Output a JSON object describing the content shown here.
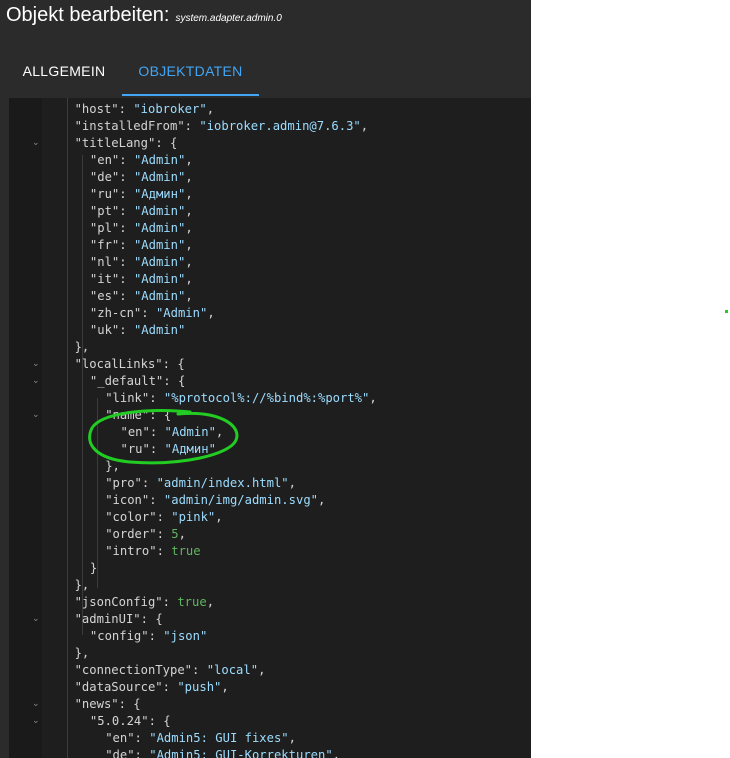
{
  "dialog": {
    "title": "Objekt bearbeiten:",
    "object_id": "system.adapter.admin.0"
  },
  "tabs": [
    {
      "label": "ALLGEMEIN",
      "active": false
    },
    {
      "label": "OBJEKTDATEN",
      "active": true
    }
  ],
  "colors": {
    "background": "#2b2b2b",
    "editor_background": "#1e1e1e",
    "accent": "#42a5f5",
    "string": "#9cdcfe",
    "literal": "#5fb65f",
    "annotation": "#22cc22"
  },
  "code_lines": [
    {
      "indent": 2,
      "tokens": [
        [
          "k",
          "\"host\""
        ],
        [
          "p",
          ": "
        ],
        [
          "s",
          "\"iobroker\""
        ],
        [
          "p",
          ","
        ]
      ]
    },
    {
      "indent": 2,
      "tokens": [
        [
          "k",
          "\"installedFrom\""
        ],
        [
          "p",
          ": "
        ],
        [
          "s",
          "\"iobroker.admin@7.6.3\""
        ],
        [
          "p",
          ","
        ]
      ]
    },
    {
      "indent": 2,
      "fold": true,
      "tokens": [
        [
          "k",
          "\"titleLang\""
        ],
        [
          "p",
          ": {"
        ]
      ]
    },
    {
      "indent": 3,
      "tokens": [
        [
          "k",
          "\"en\""
        ],
        [
          "p",
          ": "
        ],
        [
          "s",
          "\"Admin\""
        ],
        [
          "p",
          ","
        ]
      ]
    },
    {
      "indent": 3,
      "tokens": [
        [
          "k",
          "\"de\""
        ],
        [
          "p",
          ": "
        ],
        [
          "s",
          "\"Admin\""
        ],
        [
          "p",
          ","
        ]
      ]
    },
    {
      "indent": 3,
      "tokens": [
        [
          "k",
          "\"ru\""
        ],
        [
          "p",
          ": "
        ],
        [
          "s",
          "\"Админ\""
        ],
        [
          "p",
          ","
        ]
      ]
    },
    {
      "indent": 3,
      "tokens": [
        [
          "k",
          "\"pt\""
        ],
        [
          "p",
          ": "
        ],
        [
          "s",
          "\"Admin\""
        ],
        [
          "p",
          ","
        ]
      ]
    },
    {
      "indent": 3,
      "tokens": [
        [
          "k",
          "\"pl\""
        ],
        [
          "p",
          ": "
        ],
        [
          "s",
          "\"Admin\""
        ],
        [
          "p",
          ","
        ]
      ]
    },
    {
      "indent": 3,
      "tokens": [
        [
          "k",
          "\"fr\""
        ],
        [
          "p",
          ": "
        ],
        [
          "s",
          "\"Admin\""
        ],
        [
          "p",
          ","
        ]
      ]
    },
    {
      "indent": 3,
      "tokens": [
        [
          "k",
          "\"nl\""
        ],
        [
          "p",
          ": "
        ],
        [
          "s",
          "\"Admin\""
        ],
        [
          "p",
          ","
        ]
      ]
    },
    {
      "indent": 3,
      "tokens": [
        [
          "k",
          "\"it\""
        ],
        [
          "p",
          ": "
        ],
        [
          "s",
          "\"Admin\""
        ],
        [
          "p",
          ","
        ]
      ]
    },
    {
      "indent": 3,
      "tokens": [
        [
          "k",
          "\"es\""
        ],
        [
          "p",
          ": "
        ],
        [
          "s",
          "\"Admin\""
        ],
        [
          "p",
          ","
        ]
      ]
    },
    {
      "indent": 3,
      "tokens": [
        [
          "k",
          "\"zh-cn\""
        ],
        [
          "p",
          ": "
        ],
        [
          "s",
          "\"Admin\""
        ],
        [
          "p",
          ","
        ]
      ]
    },
    {
      "indent": 3,
      "tokens": [
        [
          "k",
          "\"uk\""
        ],
        [
          "p",
          ": "
        ],
        [
          "s",
          "\"Admin\""
        ]
      ]
    },
    {
      "indent": 2,
      "tokens": [
        [
          "p",
          "},"
        ]
      ]
    },
    {
      "indent": 2,
      "fold": true,
      "tokens": [
        [
          "k",
          "\"localLinks\""
        ],
        [
          "p",
          ": {"
        ]
      ]
    },
    {
      "indent": 3,
      "fold": true,
      "tokens": [
        [
          "k",
          "\"_default\""
        ],
        [
          "p",
          ": {"
        ]
      ]
    },
    {
      "indent": 4,
      "tokens": [
        [
          "k",
          "\"link\""
        ],
        [
          "p",
          ": "
        ],
        [
          "s",
          "\"%protocol%://%bind%:%port%\""
        ],
        [
          "p",
          ","
        ]
      ]
    },
    {
      "indent": 4,
      "fold": true,
      "tokens": [
        [
          "k",
          "\"name\""
        ],
        [
          "p",
          ": {"
        ]
      ]
    },
    {
      "indent": 5,
      "tokens": [
        [
          "k",
          "\"en\""
        ],
        [
          "p",
          ": "
        ],
        [
          "s",
          "\"Admin\""
        ],
        [
          "p",
          ","
        ]
      ]
    },
    {
      "indent": 5,
      "tokens": [
        [
          "k",
          "\"ru\""
        ],
        [
          "p",
          ": "
        ],
        [
          "s",
          "\"Админ\""
        ]
      ]
    },
    {
      "indent": 4,
      "tokens": [
        [
          "p",
          "},"
        ]
      ]
    },
    {
      "indent": 4,
      "tokens": [
        [
          "k",
          "\"pro\""
        ],
        [
          "p",
          ": "
        ],
        [
          "s",
          "\"admin/index.html\""
        ],
        [
          "p",
          ","
        ]
      ]
    },
    {
      "indent": 4,
      "tokens": [
        [
          "k",
          "\"icon\""
        ],
        [
          "p",
          ": "
        ],
        [
          "s",
          "\"admin/img/admin.svg\""
        ],
        [
          "p",
          ","
        ]
      ]
    },
    {
      "indent": 4,
      "tokens": [
        [
          "k",
          "\"color\""
        ],
        [
          "p",
          ": "
        ],
        [
          "s",
          "\"pink\""
        ],
        [
          "p",
          ","
        ]
      ]
    },
    {
      "indent": 4,
      "tokens": [
        [
          "k",
          "\"order\""
        ],
        [
          "p",
          ": "
        ],
        [
          "n",
          "5"
        ],
        [
          "p",
          ","
        ]
      ]
    },
    {
      "indent": 4,
      "tokens": [
        [
          "k",
          "\"intro\""
        ],
        [
          "p",
          ": "
        ],
        [
          "n",
          "true"
        ]
      ]
    },
    {
      "indent": 3,
      "tokens": [
        [
          "p",
          "}"
        ]
      ]
    },
    {
      "indent": 2,
      "tokens": [
        [
          "p",
          "},"
        ]
      ]
    },
    {
      "indent": 2,
      "tokens": [
        [
          "k",
          "\"jsonConfig\""
        ],
        [
          "p",
          ": "
        ],
        [
          "n",
          "true"
        ],
        [
          "p",
          ","
        ]
      ]
    },
    {
      "indent": 2,
      "fold": true,
      "tokens": [
        [
          "k",
          "\"adminUI\""
        ],
        [
          "p",
          ": {"
        ]
      ]
    },
    {
      "indent": 3,
      "tokens": [
        [
          "k",
          "\"config\""
        ],
        [
          "p",
          ": "
        ],
        [
          "s",
          "\"json\""
        ]
      ]
    },
    {
      "indent": 2,
      "tokens": [
        [
          "p",
          "},"
        ]
      ]
    },
    {
      "indent": 2,
      "tokens": [
        [
          "k",
          "\"connectionType\""
        ],
        [
          "p",
          ": "
        ],
        [
          "s",
          "\"local\""
        ],
        [
          "p",
          ","
        ]
      ]
    },
    {
      "indent": 2,
      "tokens": [
        [
          "k",
          "\"dataSource\""
        ],
        [
          "p",
          ": "
        ],
        [
          "s",
          "\"push\""
        ],
        [
          "p",
          ","
        ]
      ]
    },
    {
      "indent": 2,
      "fold": true,
      "tokens": [
        [
          "k",
          "\"news\""
        ],
        [
          "p",
          ": {"
        ]
      ]
    },
    {
      "indent": 3,
      "fold": true,
      "tokens": [
        [
          "k",
          "\"5.0.24\""
        ],
        [
          "p",
          ": {"
        ]
      ]
    },
    {
      "indent": 4,
      "tokens": [
        [
          "k",
          "\"en\""
        ],
        [
          "p",
          ": "
        ],
        [
          "s",
          "\"Admin5: GUI fixes\""
        ],
        [
          "p",
          ","
        ]
      ]
    },
    {
      "indent": 4,
      "tokens": [
        [
          "k",
          "\"de\""
        ],
        [
          "p",
          ": "
        ],
        [
          "s",
          "\"Admin5: GUI-Korrekturen\""
        ],
        [
          "p",
          ","
        ]
      ]
    }
  ]
}
